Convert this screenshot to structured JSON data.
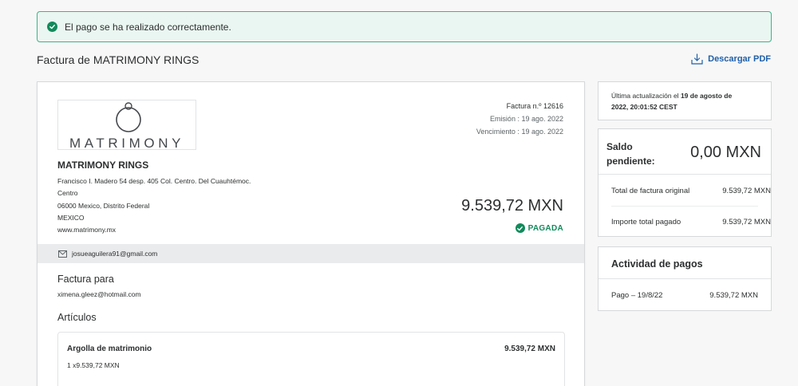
{
  "alert": {
    "message": "El pago se ha realizado correctamente.",
    "icon": "check-circle-icon",
    "color": "#128a5b"
  },
  "header": {
    "title": "Factura de MATRIMONY RINGS",
    "download_label": "Descargar PDF",
    "download_icon": "download-icon"
  },
  "invoice": {
    "logo_text": "MATRIMONY",
    "number": "Factura n.º 12616",
    "issue_date": "Emisión : 19 ago. 2022",
    "due_date": "Vencimiento : 19 ago. 2022",
    "seller": {
      "name": "MATRIMONY RINGS",
      "address_lines": [
        "Francisco I. Madero 54 desp. 405 Col. Centro. Del Cuauhtémoc.",
        "Centro",
        "06000 Mexico, Distrito Federal",
        "MEXICO",
        "www.matrimony.mx"
      ],
      "email": "josueaguilera91@gmail.com"
    },
    "total": "9.539,72 MXN",
    "status": "PAGADA",
    "bill_to": {
      "title": "Factura para",
      "email": "ximena.gleez@hotmail.com"
    },
    "items_title": "Artículos",
    "items": [
      {
        "name": "Argolla de matrimonio",
        "price": "9.539,72 MXN",
        "quantity": "1 x9.539,72 MXN"
      }
    ]
  },
  "sidebar": {
    "updated_prefix": "Última actualización el ",
    "updated_date_bold": "19 de agosto de",
    "updated_time_bold": "2022, 20:01:52 CEST",
    "balance": {
      "label_line1": "Saldo",
      "label_line2": "pendiente:",
      "amount": "0,00 MXN",
      "rows": [
        {
          "label": "Total de factura original",
          "value": "9.539,72 MXN"
        },
        {
          "label": "Importe total pagado",
          "value": "9.539,72 MXN"
        }
      ]
    },
    "activity": {
      "title": "Actividad de pagos",
      "rows": [
        {
          "label": "Pago – 19/8/22",
          "value": "9.539,72 MXN"
        }
      ]
    }
  }
}
